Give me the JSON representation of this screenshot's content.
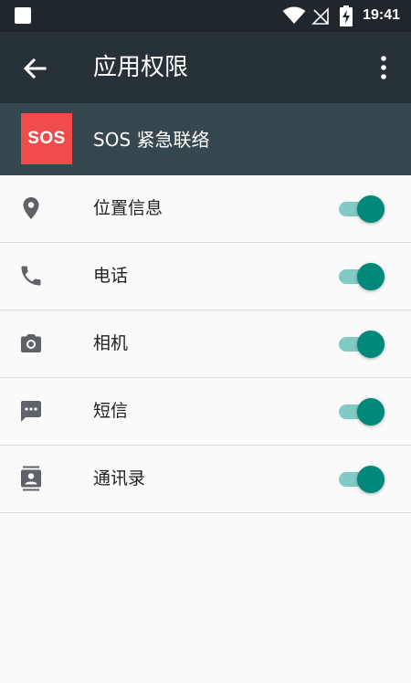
{
  "status_bar": {
    "time": "19:41",
    "icons": [
      "notification-square-icon",
      "wifi-icon",
      "no-signal-icon",
      "battery-charging-icon"
    ]
  },
  "app_bar": {
    "title": "应用权限",
    "back_icon": "arrow-back-icon",
    "menu_icon": "more-vert-icon"
  },
  "app_header": {
    "logo_text": "SOS",
    "name": "SOS 紧急联络"
  },
  "permissions": [
    {
      "label": "位置信息",
      "icon": "location-pin-icon",
      "enabled": true
    },
    {
      "label": "电话",
      "icon": "phone-icon",
      "enabled": true
    },
    {
      "label": "相机",
      "icon": "camera-icon",
      "enabled": true
    },
    {
      "label": "短信",
      "icon": "sms-icon",
      "enabled": true
    },
    {
      "label": "通讯录",
      "icon": "contacts-icon",
      "enabled": true
    }
  ],
  "colors": {
    "status_bar": "#1f272d",
    "app_bar": "#263238",
    "app_header": "#37474f",
    "logo_bg": "#f14b4b",
    "switch_thumb": "#00897b",
    "switch_track": "#80cbc4",
    "page_bg": "#fafafa"
  }
}
